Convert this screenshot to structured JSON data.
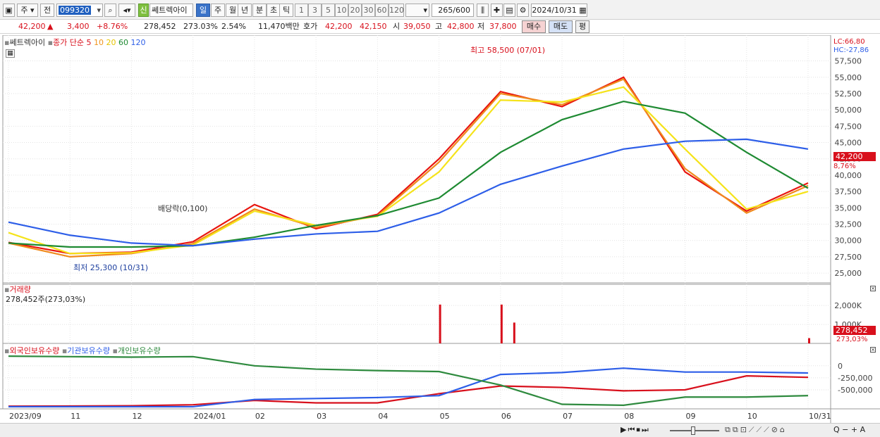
{
  "toolbar": {
    "market": "주",
    "prev_label": "전",
    "code": "099320",
    "new_badge": "신",
    "stock_name": "쎄트렉아이",
    "periods": [
      "일",
      "주",
      "월",
      "년",
      "분",
      "초",
      "틱"
    ],
    "active_period": "일",
    "numbers": [
      "1",
      "3",
      "5",
      "10",
      "20",
      "30",
      "60",
      "120"
    ],
    "count": "265",
    "count_total": "/600",
    "date": "2024/10/31"
  },
  "quote": {
    "price": "42,200",
    "change": "3,400",
    "change_pct": "+8.76%",
    "volume": "278,452",
    "volume_ratio": "273.03%",
    "turnover_rate": "2.54%",
    "amount": "11,470백만",
    "bid_label": "호가",
    "bid1": "42,200",
    "bid2": "42,150",
    "open_label": "시",
    "open": "39,050",
    "high_label": "고",
    "high": "42,800",
    "low_label": "저",
    "low": "37,800",
    "buy_label": "매수",
    "sell_label": "매도",
    "avg_label": "평"
  },
  "legend": {
    "stock": "쎄트렉아이",
    "ma_title": "종가 단순",
    "ma_periods": [
      "5",
      "10",
      "20",
      "60",
      "120"
    ],
    "ma_colors": [
      "#e8150f",
      "#f08a1c",
      "#f5e31a",
      "#1e8a32",
      "#2d5ee8"
    ],
    "lc": "LC:66,80",
    "hc": "HC:-27,86",
    "volume_title": "거래량",
    "volume_value": "278,452주(273,03%)",
    "holding_series": [
      "외국인보유수량",
      "기관보유수량",
      "개인보유수량"
    ]
  },
  "annotations": {
    "high": "최고 58,500 (07/01)",
    "low": "최저 25,300 (10/31)",
    "dividend": "배당락(0,100)",
    "price_tag": "42,200",
    "price_tag_pct": "8,76%",
    "vol_tag": "278,452",
    "vol_tag_pct": "273,03%"
  },
  "chart_data": {
    "type": "line",
    "title": "",
    "x_labels": [
      "2023/09",
      "11",
      "12",
      "2024/01",
      "02",
      "03",
      "04",
      "05",
      "06",
      "07",
      "08",
      "09",
      "10",
      "10/31"
    ],
    "price_ticks": [
      "57,500",
      "55,000",
      "52,500",
      "50,000",
      "47,500",
      "45,000",
      "42,500",
      "40,000",
      "37,500",
      "35,000",
      "32,500",
      "30,000",
      "27,500",
      "25,000"
    ],
    "price_ylim": [
      23500,
      59500
    ],
    "volume_ticks": [
      "2,000K",
      "1,000K"
    ],
    "volume_ylim": [
      0,
      2600000
    ],
    "holding_ticks": [
      "0",
      "-250,000",
      "-500,000"
    ],
    "holding_ylim": [
      -880000,
      260000
    ],
    "x": [
      "2023-09",
      "2023-10",
      "2023-11",
      "2023-12",
      "2024-01",
      "2024-02",
      "2024-03",
      "2024-04",
      "2024-05",
      "2024-06",
      "2024-07",
      "2024-08",
      "2024-09",
      "2024-10"
    ],
    "series": [
      {
        "name": "5",
        "color": "#e8150f",
        "values": [
          29700,
          28000,
          28200,
          29800,
          35500,
          31800,
          34000,
          42500,
          52800,
          50500,
          55000,
          40500,
          34500,
          38800
        ]
      },
      {
        "name": "10",
        "color": "#f08a1c",
        "values": [
          29600,
          27500,
          28000,
          29500,
          34800,
          32000,
          33800,
          42000,
          52500,
          50800,
          54700,
          41000,
          34200,
          38400
        ]
      },
      {
        "name": "20",
        "color": "#f5e31a",
        "values": [
          31200,
          28000,
          28100,
          29300,
          34500,
          32300,
          33700,
          40500,
          51500,
          51200,
          53500,
          44000,
          34800,
          37500
        ]
      },
      {
        "name": "60",
        "color": "#1e8a32",
        "values": [
          29600,
          29000,
          29000,
          29200,
          30500,
          32300,
          33800,
          36500,
          43500,
          48500,
          51300,
          49500,
          43500,
          38000
        ]
      },
      {
        "name": "120",
        "color": "#2d5ee8",
        "values": [
          32800,
          30800,
          29600,
          29200,
          30200,
          31000,
          31400,
          34200,
          38600,
          41400,
          44000,
          45200,
          45500,
          44000
        ]
      }
    ],
    "volume_spikes": [
      {
        "x": "2024-04",
        "value": 2050000
      },
      {
        "x": "2024-05",
        "value": 2050000
      },
      {
        "x": "2024-05",
        "value": 1100000
      },
      {
        "x": "2024-10-31",
        "value": 278452
      }
    ],
    "holding_series": [
      {
        "name": "외국인보유수량",
        "color": "#d8101c",
        "values": [
          -840000,
          -835000,
          -830000,
          -810000,
          -720000,
          -770000,
          -770000,
          -580000,
          -420000,
          -450000,
          -520000,
          -500000,
          -210000,
          -240000
        ]
      },
      {
        "name": "기관보유수량",
        "color": "#2d5ee8",
        "values": [
          -850000,
          -850000,
          -850000,
          -850000,
          -700000,
          -680000,
          -660000,
          -620000,
          -180000,
          -140000,
          -50000,
          -130000,
          -130000,
          -150000
        ]
      },
      {
        "name": "개인보유수량",
        "color": "#2e8a3e",
        "values": [
          200000,
          190000,
          180000,
          190000,
          0,
          -70000,
          -100000,
          -120000,
          -400000,
          -800000,
          -820000,
          -650000,
          -650000,
          -620000
        ]
      }
    ],
    "grid": true
  }
}
